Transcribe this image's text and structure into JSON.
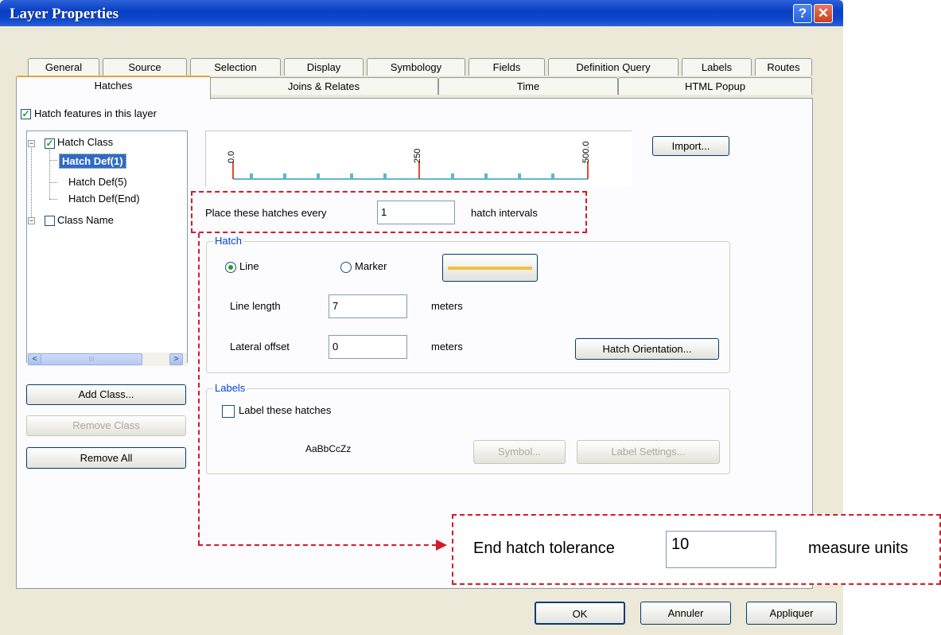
{
  "window": {
    "title": "Layer Properties",
    "help_glyph": "?",
    "close_glyph": "✕"
  },
  "tabs": {
    "row1": [
      "General",
      "Source",
      "Selection",
      "Display",
      "Symbology",
      "Fields",
      "Definition Query",
      "Labels",
      "Routes"
    ],
    "row2": [
      "Hatches",
      "Joins & Relates",
      "Time",
      "HTML Popup"
    ],
    "active": "Hatches"
  },
  "hatch_features_checkbox": {
    "label": "Hatch features in this layer",
    "checked": true
  },
  "tree": {
    "items": [
      {
        "label": "Hatch Class",
        "checked": true
      },
      {
        "label": "Hatch Def(1)",
        "selected": true
      },
      {
        "label": "Hatch Def(5)"
      },
      {
        "label": "Hatch Def(End)"
      },
      {
        "label": "Class Name",
        "checked": false
      }
    ],
    "scroll_left": "<",
    "scroll_right": ">",
    "thumb_grip": "III"
  },
  "class_buttons": {
    "add": "Add Class...",
    "remove": "Remove Class",
    "remove_all": "Remove All"
  },
  "ruler": {
    "labels": [
      "0.0",
      "250",
      "500.0"
    ]
  },
  "import_button": "Import...",
  "interval": {
    "label": "Place these hatches every",
    "value": "1",
    "unit": "hatch intervals"
  },
  "hatch_group": {
    "legend": "Hatch",
    "line_radio": "Line",
    "marker_radio": "Marker",
    "selected": "Line",
    "symbol_color": "#f0c040",
    "line_length_label": "Line length",
    "line_length_value": "7",
    "line_length_unit": "meters",
    "lateral_offset_label": "Lateral offset",
    "lateral_offset_value": "0",
    "lateral_offset_unit": "meters",
    "orientation_button": "Hatch Orientation..."
  },
  "labels_group": {
    "legend": "Labels",
    "label_checkbox": "Label these hatches",
    "checked": false,
    "sample": "AaBbCcZz",
    "symbol_button": "Symbol...",
    "settings_button": "Label Settings..."
  },
  "callout": {
    "label": "End hatch tolerance",
    "value": "10",
    "unit": "measure units",
    "color": "#d8182a"
  },
  "dialog_buttons": {
    "ok": "OK",
    "cancel": "Annuler",
    "apply": "Appliquer"
  }
}
